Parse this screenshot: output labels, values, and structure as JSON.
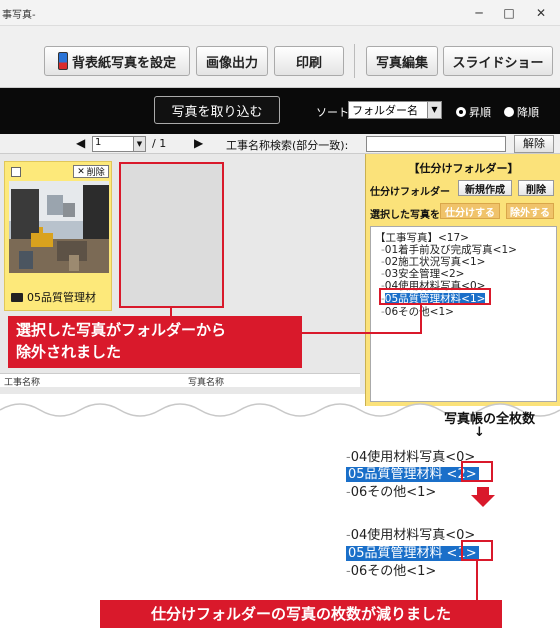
{
  "titlebar": {
    "title": "事写真-",
    "min": "─",
    "max": "□",
    "close": "✕"
  },
  "toolbar": {
    "cover_photo": "背表紙写真を設定",
    "image_output": "画像出力",
    "print": "印刷",
    "photo_edit": "写真編集",
    "slideshow": "スライドショー"
  },
  "import": {
    "label": "写真を取り込む"
  },
  "sort": {
    "label": "ソート",
    "value": "フォルダー名",
    "asc": "昇順",
    "desc": "降順",
    "selected": "asc"
  },
  "pager": {
    "prev": "◀",
    "next": "▶",
    "page": "1",
    "total": "/ 1",
    "search_label": "工事名称検索(部分一致):",
    "search_value": "",
    "clear": "解除"
  },
  "card": {
    "delete": "削除",
    "label": "05品質管理材",
    "checked": false
  },
  "panel": {
    "title": "【仕分けフォルダー】",
    "folder_label": "仕分けフォルダー",
    "new_btn": "新規作成",
    "delete_btn": "削除",
    "selected_label": "選択した写真を",
    "sort_btn": "仕分けする",
    "exclude_btn": "除外する"
  },
  "tree": [
    "【工事写真】<17>",
    "01着手前及び完成写真<1>",
    "02施工状況写真<1>",
    "03安全管理<2>",
    "04使用材料写真<0>",
    "05品質管理材料<1>",
    "06その他<1>"
  ],
  "columns": {
    "work_name": "工事名称",
    "photo_name": "写真名称"
  },
  "callout1": [
    "選択した写真がフォルダーから",
    "除外されました"
  ],
  "zoom": {
    "count_label": "写真帳の全枚数",
    "before": {
      "row1": "04使用材料写真<0>",
      "row2_name": "05品質管理材料",
      "row2_count": "<2>",
      "row3": "06その他<1>"
    },
    "after": {
      "row1": "04使用材料写真<0>",
      "row2_name": "05品質管理材料",
      "row2_count": "<1>",
      "row3": "06その他<1>"
    }
  },
  "callout2": "仕分けフォルダーの写真の枚数が減りました",
  "colors": {
    "accent_red": "#d9192b",
    "selection_blue": "#1a6fc9",
    "panel_yellow": "#fbe27a"
  }
}
